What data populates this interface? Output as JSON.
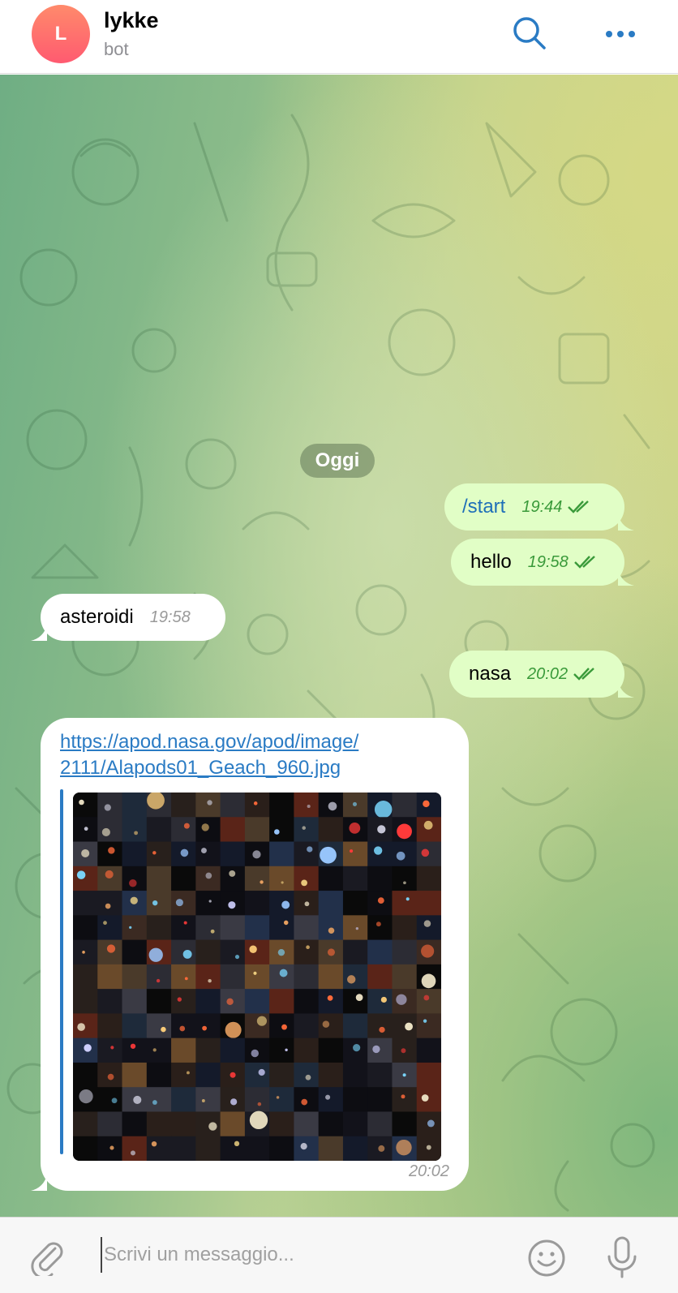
{
  "header": {
    "avatar_letter": "L",
    "title": "lykke",
    "subtitle": "bot",
    "search_icon": "search-icon",
    "more_icon": "more-dots-icon"
  },
  "colors": {
    "accent": "#2a7bc4",
    "outgoing_bubble": "#e1fec6",
    "incoming_bubble": "#ffffff",
    "read_checks": "#3a9a3a"
  },
  "chat": {
    "date_separator": "Oggi",
    "messages": [
      {
        "direction": "out",
        "text": "/start",
        "time": "19:44",
        "status": "read"
      },
      {
        "direction": "out",
        "text": "hello",
        "time": "19:58",
        "status": "read"
      },
      {
        "direction": "in",
        "text": "asteroidi",
        "time": "19:58"
      },
      {
        "direction": "out",
        "text": "nasa",
        "time": "20:02",
        "status": "read"
      },
      {
        "direction": "in",
        "link_line1": "https://apod.nasa.gov/apod/image/",
        "link_line2": "2111/Alapods01_Geach_960.jpg",
        "time": "20:02"
      }
    ]
  },
  "composer": {
    "placeholder": "Scrivi un messaggio...",
    "value": "",
    "attach_icon": "paperclip-icon",
    "emoji_icon": "emoji-icon",
    "mic_icon": "microphone-icon"
  }
}
